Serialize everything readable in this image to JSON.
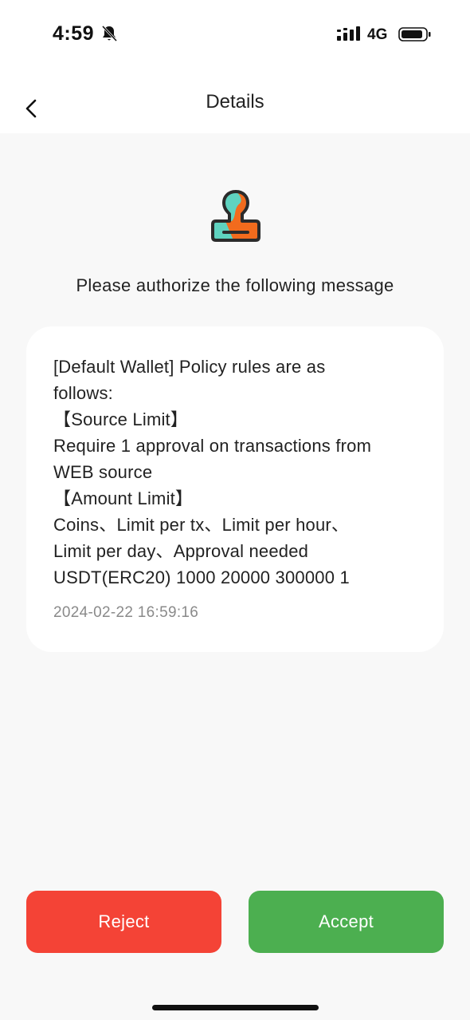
{
  "status_bar": {
    "time": "4:59",
    "network": "4G",
    "icons": [
      "bell-slash-icon",
      "signal-icon",
      "battery-icon"
    ]
  },
  "nav": {
    "title": "Details",
    "back_icon": "chevron-left-icon"
  },
  "content": {
    "icon": "stamp-icon",
    "prompt": "Please authorize the following message",
    "message_lines": [
      "[Default Wallet] Policy rules are as",
      "follows:",
      "【Source Limit】",
      "Require 1 approval on transactions from",
      "WEB source",
      "【Amount Limit】",
      "Coins、Limit per tx、Limit per hour、",
      "Limit per day、Approval needed",
      "USDT(ERC20) 1000 20000 300000 1"
    ],
    "timestamp": "2024-02-22 16:59:16"
  },
  "actions": {
    "reject_label": "Reject",
    "accept_label": "Accept",
    "reject_color": "#f44336",
    "accept_color": "#4caf50"
  },
  "colors": {
    "stamp_teal": "#5fd3c0",
    "stamp_orange": "#f26b1d"
  }
}
